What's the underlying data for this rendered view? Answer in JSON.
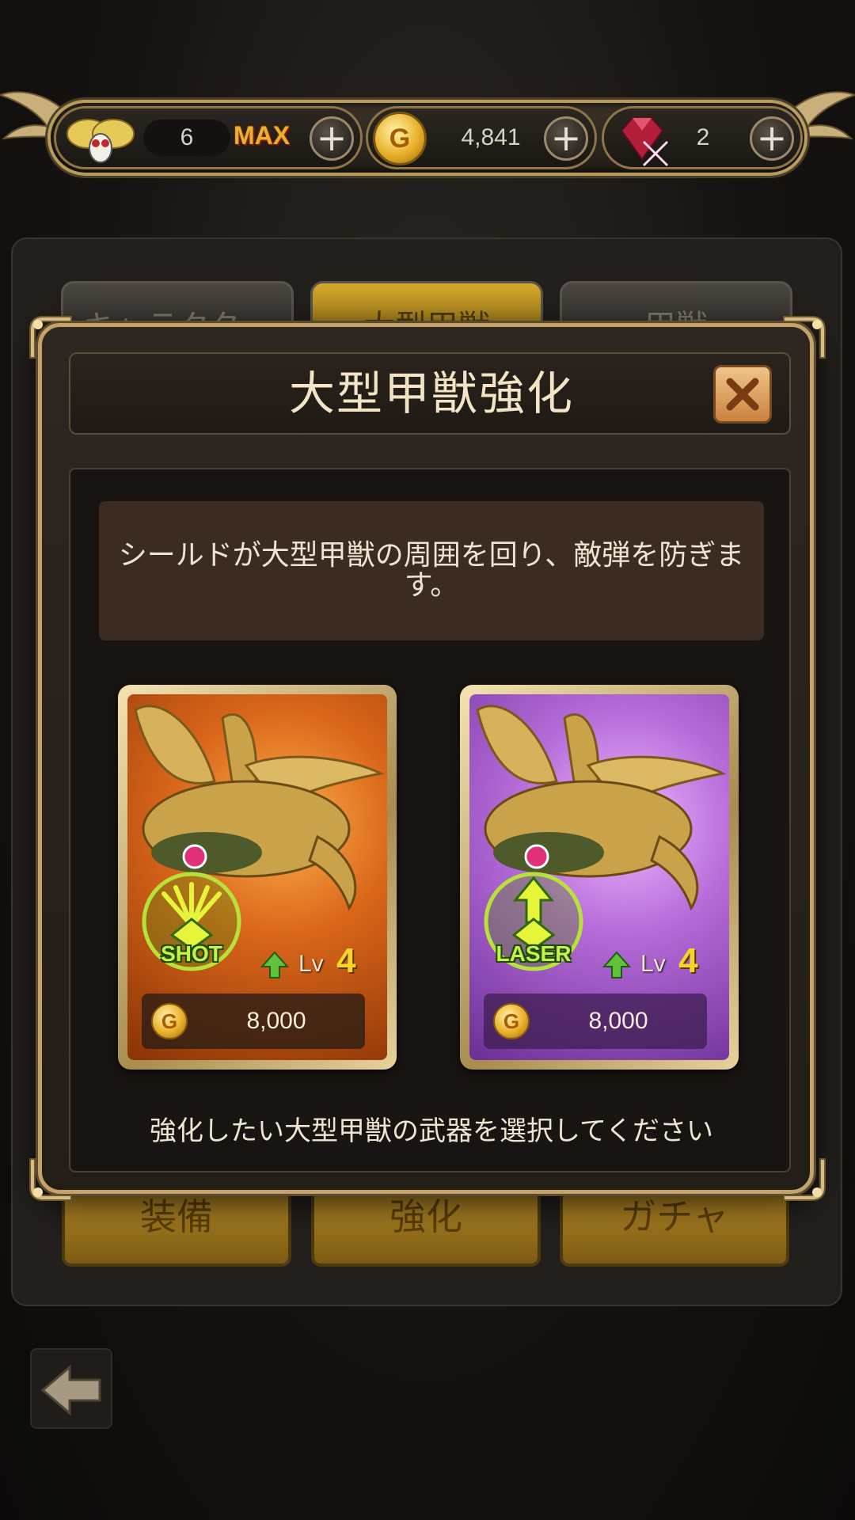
{
  "resources": {
    "stamina": {
      "icon": "bee-stamina-icon",
      "value": "6",
      "max_label": "MAX"
    },
    "gold": {
      "icon": "gold-coin-icon",
      "coin_letter": "G",
      "value": "4,841"
    },
    "gems": {
      "icon": "ruby-gem-icon",
      "value": "2"
    },
    "plus_symbol": "+"
  },
  "background": {
    "tabs": [
      "キャラクター",
      "大型甲獣",
      "甲獣"
    ],
    "buttons": [
      "装備",
      "強化",
      "ガチャ"
    ]
  },
  "modal": {
    "title": "大型甲獣強化",
    "description": "シールドが大型甲獣の周囲を回り、敵弾を防ぎます。",
    "cards": [
      {
        "weapon": "SHOT",
        "lv_label": "Lv",
        "level": "4",
        "coin_letter": "G",
        "price": "8,000",
        "color": "#d9661a"
      },
      {
        "weapon": "LASER",
        "lv_label": "Lv",
        "level": "4",
        "coin_letter": "G",
        "price": "8,000",
        "color": "#b56ad8"
      }
    ],
    "instruction": "強化したい大型甲獣の武器を選択してください"
  },
  "colors": {
    "gold_frame": "#c4a36a",
    "accent_yellow": "#f6d42a",
    "close_orange": "#e6a260"
  }
}
